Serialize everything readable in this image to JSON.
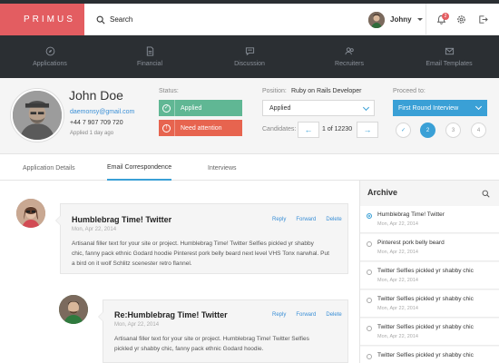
{
  "brand": "PRIMUS",
  "search_label": "Search",
  "user": {
    "name": "Johny",
    "notifications": "2"
  },
  "nav": [
    {
      "label": "Applications",
      "icon": "compass-icon"
    },
    {
      "label": "Financial",
      "icon": "document-icon"
    },
    {
      "label": "Discussion",
      "icon": "chat-icon"
    },
    {
      "label": "Recruiters",
      "icon": "users-icon"
    },
    {
      "label": "Email Templates",
      "icon": "mail-icon"
    }
  ],
  "candidate": {
    "name": "John Doe",
    "email": "daemonsy@gmail.com",
    "phone": "+44 7 907 709 720",
    "applied": "Applied 1 day ago",
    "status_label": "Status:",
    "status_applied": "Applied",
    "status_attention": "Need attention",
    "position_label": "Position:",
    "position_value": "Ruby on Rails Developer",
    "stage_select": "Applied",
    "candidates_label": "Candidates:",
    "candidates_pager": "1 of 12230",
    "proceed_label": "Proceed to:",
    "proceed_value": "First Round Interview",
    "steps": [
      "✓",
      "2",
      "3",
      "4"
    ]
  },
  "tabs": [
    "Application Details",
    "Email Correspondence",
    "Interviews"
  ],
  "messages": [
    {
      "title": "Humblebrag Time!   Twitter",
      "date": "Mon, Apr 22, 2014",
      "actions": [
        "Reply",
        "Forward",
        "Delete"
      ],
      "body": [
        "Artisanal filler text for your site or project.    Humblebrag Time!   Twitter Selfies pickled yr shabby",
        "chic, fanny pack ethnic Godard hoodie Pinterest pork belly beard next level VHS Tonx narwhal.  Put",
        "a bird on it wolf Schlitz scenester retro flannel."
      ]
    },
    {
      "title": "Re:Humblebrag Time!   Twitter",
      "date": "Mon, Apr 22, 2014",
      "actions": [
        "Reply",
        "Forward",
        "Delete"
      ],
      "body": [
        "Artisanal filler text for your site or project.    Humblebrag Time!   Twitter Selfies",
        "pickled yr shabby chic, fanny pack ethnic Godard hoodie."
      ]
    }
  ],
  "archive": {
    "title": "Archive",
    "items": [
      {
        "title": "Humblebrag Time!   Twitter",
        "date": "Mon, Apr 22, 2014"
      },
      {
        "title": "Pinterest pork belly beard",
        "date": "Mon, Apr 22, 2014"
      },
      {
        "title": "Twitter Selfies pickled yr shabby chic",
        "date": "Mon, Apr 22, 2014"
      },
      {
        "title": "Twitter Selfies pickled yr shabby chic",
        "date": "Mon, Apr 22, 2014"
      },
      {
        "title": "Twitter Selfies pickled yr shabby chic",
        "date": "Mon, Apr 22, 2014"
      },
      {
        "title": "Twitter Selfies pickled yr shabby chic",
        "date": ""
      }
    ]
  },
  "colors": {
    "brand": "#e35d61",
    "nav_bg": "#2b2f33",
    "accent": "#3aa0d6",
    "success": "#60b794",
    "danger": "#e7644f"
  }
}
